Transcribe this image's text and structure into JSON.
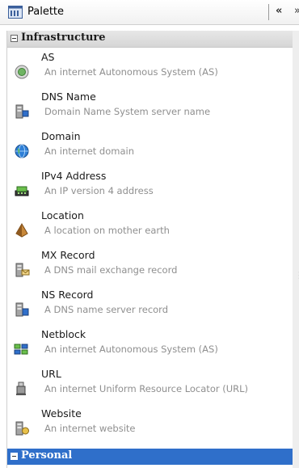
{
  "titlebar": {
    "title": "Palette",
    "icon": "palette-icon",
    "collapse_glyph": "«",
    "next_glyph": "»"
  },
  "categories": {
    "infrastructure": {
      "label": "Infrastructure",
      "state": "expanded"
    },
    "personal": {
      "label": "Personal",
      "state": "selected"
    }
  },
  "items": [
    {
      "name": "AS",
      "description": "An internet Autonomous System (AS)",
      "icon": "as-icon"
    },
    {
      "name": "DNS Name",
      "description": "Domain Name System server name",
      "icon": "dns-name-icon"
    },
    {
      "name": "Domain",
      "description": "An internet domain",
      "icon": "domain-icon"
    },
    {
      "name": "IPv4 Address",
      "description": "An IP version 4 address",
      "icon": "ipv4-address-icon"
    },
    {
      "name": "Location",
      "description": "A location on mother earth",
      "icon": "location-icon"
    },
    {
      "name": "MX Record",
      "description": "A DNS mail exchange record",
      "icon": "mx-record-icon"
    },
    {
      "name": "NS Record",
      "description": "A DNS name server record",
      "icon": "ns-record-icon"
    },
    {
      "name": "Netblock",
      "description": "An internet Autonomous System (AS)",
      "icon": "netblock-icon"
    },
    {
      "name": "URL",
      "description": "An internet Uniform Resource Locator (URL)",
      "icon": "url-icon"
    },
    {
      "name": "Website",
      "description": "An internet website",
      "icon": "website-icon"
    }
  ],
  "colors": {
    "selected_category": "#2f6fca",
    "category_header": "#dddddd",
    "description_text": "#8f8f8f"
  }
}
